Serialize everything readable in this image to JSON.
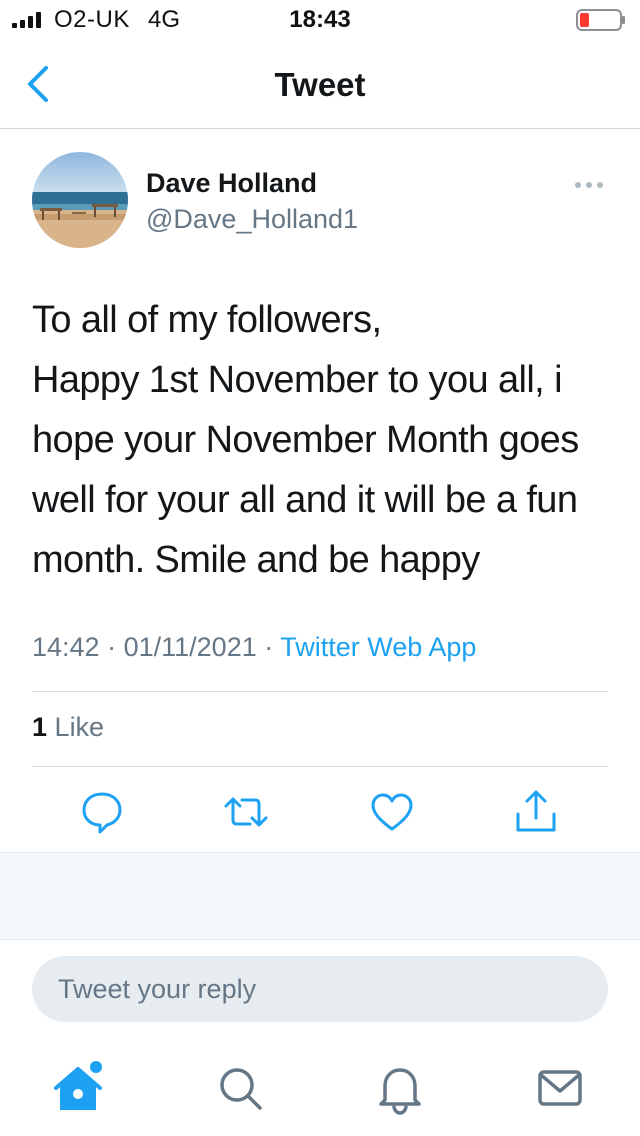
{
  "status_bar": {
    "carrier": "O2-UK",
    "network": "4G",
    "time": "18:43",
    "battery_color": "#ff3b30"
  },
  "header": {
    "title": "Tweet",
    "back_icon": "chevron-left-icon"
  },
  "tweet": {
    "author_name": "Dave Holland",
    "author_handle": "@Dave_Holland1",
    "text_lines": [
      "To all of my followers,",
      "Happy 1st November to you all, i",
      "hope your November Month goes",
      "well for your all and it will be a fun",
      "month. Smile and be happy"
    ],
    "time": "14:42",
    "date": "01/11/2021",
    "source": "Twitter Web App",
    "like_count": "1",
    "like_label": "Like"
  },
  "actions": [
    "reply-icon",
    "retweet-icon",
    "like-icon",
    "share-icon"
  ],
  "reply": {
    "placeholder": "Tweet your reply"
  },
  "tabbar": [
    "home-icon",
    "search-icon",
    "notifications-icon",
    "messages-icon"
  ],
  "colors": {
    "accent": "#1da1f2",
    "secondary_text": "#657786",
    "primary_text": "#14171a"
  }
}
